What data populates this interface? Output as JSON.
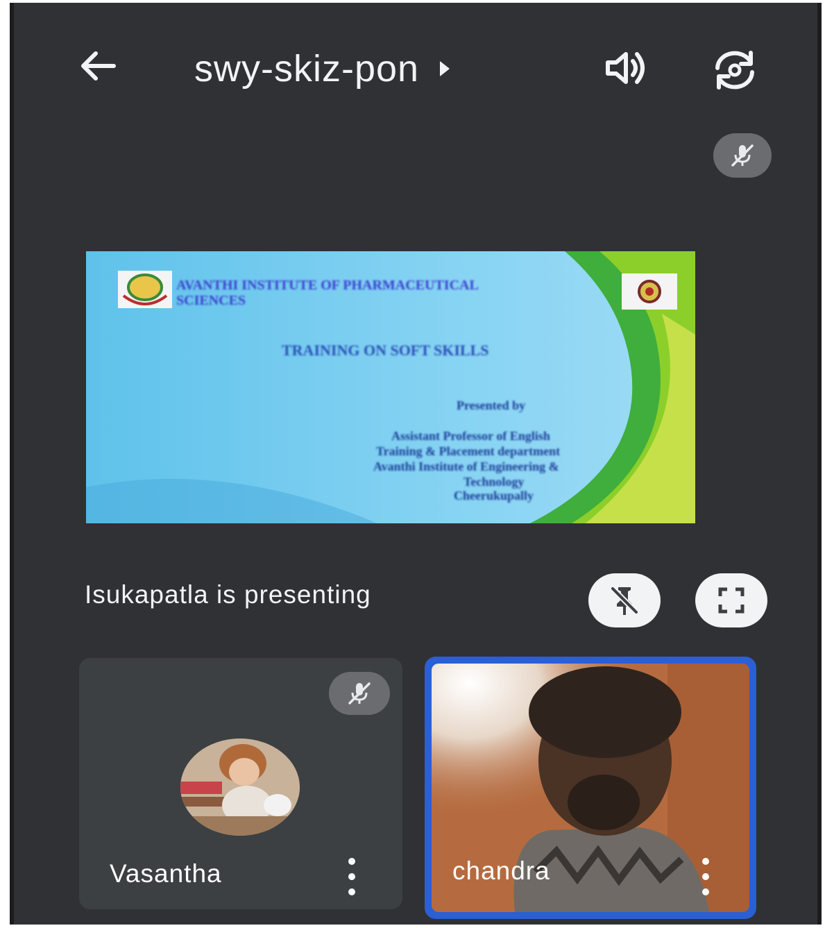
{
  "header": {
    "meeting_code": "swy-skiz-pon",
    "back_icon": "arrow-left-icon",
    "speaker_icon": "speaker-icon",
    "flip_camera_icon": "camera-flip-icon"
  },
  "presentation": {
    "slide": {
      "institute": "AVANTHI INSTITUTE OF PHARMACEUTICAL SCIENCES",
      "title": "TRAINING ON SOFT SKILLS",
      "presented_by": "Presented by",
      "role_lines": [
        "Assistant Professor of English",
        "Training & Placement department",
        "Avanthi Institute of Engineering &",
        "Technology",
        "Cheerukupally"
      ]
    },
    "status_text": "Isukapatla is presenting",
    "unpin_icon": "pin-off-icon",
    "fullscreen_icon": "fullscreen-icon",
    "presenter_muted_icon": "mic-off-icon"
  },
  "participants": [
    {
      "name": "Vasantha",
      "muted": true,
      "more_icon": "more-vertical-icon"
    },
    {
      "name": "chandra",
      "active_speaker": true,
      "more_icon": "more-vertical-icon"
    }
  ],
  "colors": {
    "background": "#303134",
    "active_border": "#2b5fd6",
    "text": "#f1f3f4"
  }
}
